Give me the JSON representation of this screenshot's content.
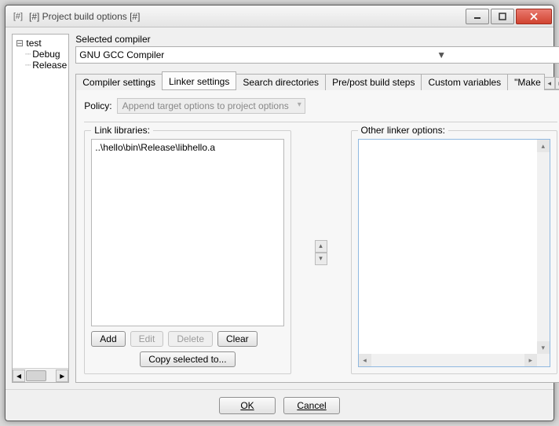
{
  "window": {
    "title": "[#] Project build options [#]"
  },
  "tree": {
    "root": "test",
    "children": [
      "Debug",
      "Release"
    ]
  },
  "selected_compiler": {
    "label": "Selected compiler",
    "value": "GNU GCC Compiler"
  },
  "tabs": {
    "items": [
      "Compiler settings",
      "Linker settings",
      "Search directories",
      "Pre/post build steps",
      "Custom variables",
      "\"Make"
    ],
    "active_index": 1
  },
  "policy": {
    "label": "Policy:",
    "value": "Append target options to project options"
  },
  "link_libraries": {
    "label": "Link libraries:",
    "items": [
      "..\\hello\\bin\\Release\\libhello.a"
    ]
  },
  "other_linker": {
    "label": "Other linker options:",
    "value": ""
  },
  "buttons": {
    "add": "Add",
    "edit": "Edit",
    "delete": "Delete",
    "clear": "Clear",
    "copy": "Copy selected to...",
    "ok": "OK",
    "cancel": "Cancel"
  }
}
